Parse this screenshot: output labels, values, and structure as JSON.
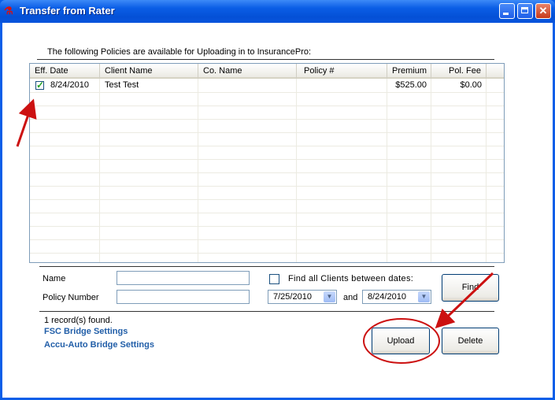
{
  "window": {
    "title": "Transfer from Rater",
    "icon": "rater-app-icon",
    "controls": [
      "minimize",
      "maximize",
      "close"
    ]
  },
  "intro_text": "The following Policies are available for Uploading in to InsurancePro:",
  "grid": {
    "columns": [
      "Eff. Date",
      "Client Name",
      "Co. Name",
      "Policy #",
      "Premium",
      "Pol. Fee"
    ],
    "rows": [
      {
        "checked": true,
        "eff_date": "8/24/2010",
        "client_name": "Test Test",
        "co_name": "",
        "policy_num": "",
        "premium": "$525.00",
        "pol_fee": "$0.00"
      }
    ]
  },
  "search": {
    "name_label": "Name",
    "name_value": "",
    "policy_label": "Policy Number",
    "policy_value": "",
    "find_all_label": "Find all Clients between dates:",
    "find_all_checked": false,
    "date_from": "7/25/2010",
    "and_label": "and",
    "date_to": "8/24/2010",
    "find_button": "Find"
  },
  "status": "1 record(s) found.",
  "links": {
    "fsc": "FSC Bridge Settings",
    "accu": "Accu-Auto Bridge Settings"
  },
  "buttons": {
    "upload": "Upload",
    "delete": "Delete"
  },
  "colors": {
    "titlebar": "#0450d6",
    "annotation": "#cc1111",
    "link": "#215ea8"
  }
}
